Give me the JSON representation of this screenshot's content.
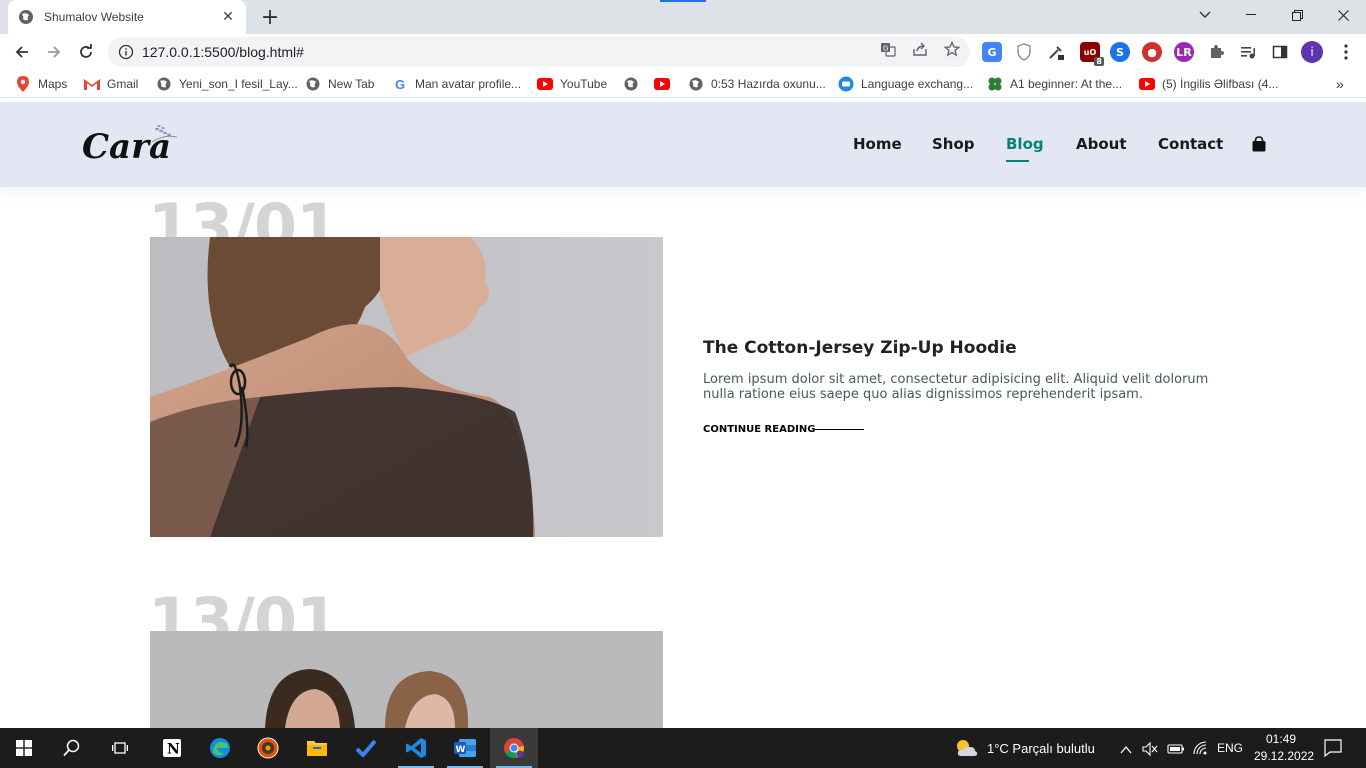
{
  "browser": {
    "tab_title": "Shumalov Website",
    "url": "127.0.0.1:5500/blog.html#",
    "bookmarks": [
      {
        "label": "Maps"
      },
      {
        "label": "Gmail"
      },
      {
        "label": "Yeni_son_I fesil_Lay..."
      },
      {
        "label": "New Tab"
      },
      {
        "label": "Man avatar profile..."
      },
      {
        "label": "YouTube"
      },
      {
        "label": ""
      },
      {
        "label": ""
      },
      {
        "label": "0:53 Hazırda oxunu..."
      },
      {
        "label": "Language exchang..."
      },
      {
        "label": "A1 beginner: At the..."
      },
      {
        "label": "(5) İngilis Əlifbası (4..."
      }
    ],
    "extension_badge": "8",
    "profile_initial": "i"
  },
  "site": {
    "nav": [
      {
        "label": "Home"
      },
      {
        "label": "Shop"
      },
      {
        "label": "Blog"
      },
      {
        "label": "About"
      },
      {
        "label": "Contact"
      }
    ],
    "accent_color": "#088178",
    "header_bg": "#e3e6f3"
  },
  "posts": [
    {
      "date": "13/01",
      "title": "The Cotton-Jersey Zip-Up Hoodie",
      "body": "Lorem ipsum dolor sit amet, consectetur adipisicing elit. Aliquid velit dolorum nulla ratione eius saepe quo alias dignissimos reprehenderit ipsam.",
      "cta": "CONTINUE READING"
    },
    {
      "date": "13/01"
    }
  ],
  "taskbar": {
    "weather": "1°C  Parçalı bulutlu",
    "language": "ENG",
    "time": "01:49",
    "date": "29.12.2022"
  }
}
